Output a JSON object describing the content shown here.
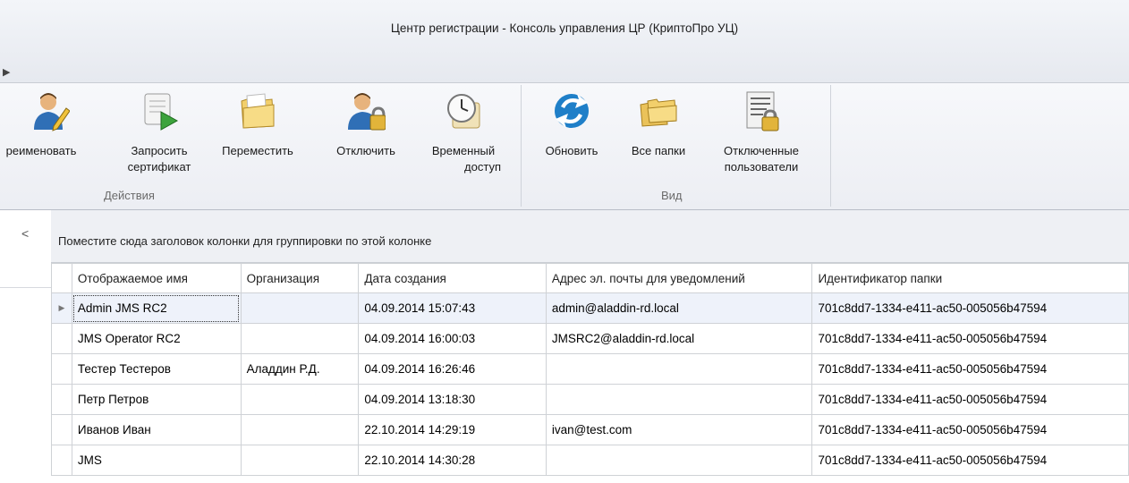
{
  "window": {
    "title": "Центр регистрации - Консоль управления ЦР (КриптоПро УЦ)"
  },
  "ribbon": {
    "groups": [
      {
        "caption": "Действия",
        "buttons": [
          {
            "label1": "реименовать",
            "label2": "",
            "icon": "user-pencil-icon"
          },
          {
            "label1": "Запросить",
            "label2": "сертификат",
            "icon": "certificate-request-icon"
          },
          {
            "label1": "Переместить",
            "label2": "",
            "icon": "move-folder-icon"
          },
          {
            "label1": "Отключить",
            "label2": "",
            "icon": "user-lock-icon"
          },
          {
            "label1": "Временный",
            "label2": "доступ",
            "icon": "clock-scroll-icon"
          }
        ]
      },
      {
        "caption": "Вид",
        "buttons": [
          {
            "label1": "Обновить",
            "label2": "",
            "icon": "refresh-icon"
          },
          {
            "label1": "Все папки",
            "label2": "",
            "icon": "folders-icon"
          },
          {
            "label1": "Отключенные",
            "label2": "пользователи",
            "icon": "document-lock-icon"
          }
        ]
      }
    ]
  },
  "leftpanel": {
    "collapse_glyph": "<"
  },
  "grid": {
    "group_hint": "Поместите сюда заголовок колонки для группировки по этой колонке",
    "columns": [
      "Отображаемое имя",
      "Организация",
      "Дата создания",
      "Адрес эл. почты для уведомлений",
      "Идентификатор папки"
    ],
    "rows": [
      [
        "Admin JMS RC2",
        "",
        "04.09.2014 15:07:43",
        "admin@aladdin-rd.local",
        "701c8dd7-1334-e411-ac50-005056b47594"
      ],
      [
        "JMS Operator RC2",
        "",
        "04.09.2014 16:00:03",
        "JMSRC2@aladdin-rd.local",
        "701c8dd7-1334-e411-ac50-005056b47594"
      ],
      [
        "Тестер Тестеров",
        "Аладдин Р.Д.",
        "04.09.2014 16:26:46",
        "",
        "701c8dd7-1334-e411-ac50-005056b47594"
      ],
      [
        "Петр Петров",
        "",
        "04.09.2014 13:18:30",
        "",
        "701c8dd7-1334-e411-ac50-005056b47594"
      ],
      [
        "Иванов Иван",
        "",
        "22.10.2014 14:29:19",
        "ivan@test.com",
        "701c8dd7-1334-e411-ac50-005056b47594"
      ],
      [
        "JMS",
        "",
        "22.10.2014 14:30:28",
        "",
        "701c8dd7-1334-e411-ac50-005056b47594"
      ]
    ],
    "current_row_glyph": "▶"
  }
}
